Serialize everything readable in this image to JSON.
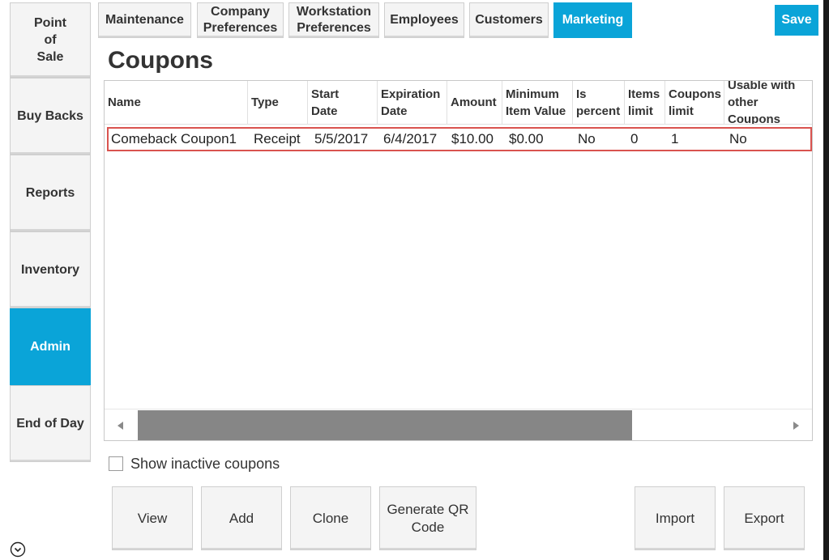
{
  "nav": {
    "items": [
      {
        "label": "Point\nof\nSale"
      },
      {
        "label": "Buy Backs"
      },
      {
        "label": "Reports"
      },
      {
        "label": "Inventory"
      },
      {
        "label": "Admin"
      },
      {
        "label": "End of Day"
      }
    ],
    "active": "Admin"
  },
  "tabs": [
    {
      "label": "Maintenance"
    },
    {
      "label": "Company\nPreferences"
    },
    {
      "label": "Workstation\nPreferences"
    },
    {
      "label": "Employees"
    },
    {
      "label": "Customers"
    },
    {
      "label": "Marketing"
    }
  ],
  "active_tab": "Marketing",
  "save_label": "Save",
  "page_title": "Coupons",
  "grid": {
    "columns": [
      "Name",
      "Type",
      "Start\nDate",
      "Expiration\nDate",
      "Amount",
      "Minimum\nItem Value",
      "Is\npercent",
      "Items\nlimit",
      "Coupons\nlimit",
      "Usable with\nother Coupons"
    ],
    "rows": [
      [
        "Comeback Coupon1",
        "Receipt",
        "5/5/2017",
        "6/4/2017",
        "$10.00",
        "$0.00",
        "No",
        "0",
        "1",
        "No"
      ]
    ]
  },
  "show_inactive_label": "Show inactive coupons",
  "actions": {
    "view": "View",
    "add": "Add",
    "clone": "Clone",
    "generate_qr": "Generate QR\nCode",
    "import": "Import",
    "export": "Export"
  },
  "colors": {
    "accent": "#0aa4d8",
    "selection_border": "#d9534f"
  },
  "icons": {
    "expand": "chevron-down-circle-icon",
    "scroll_left": "triangle-left-icon",
    "scroll_right": "triangle-right-icon"
  }
}
